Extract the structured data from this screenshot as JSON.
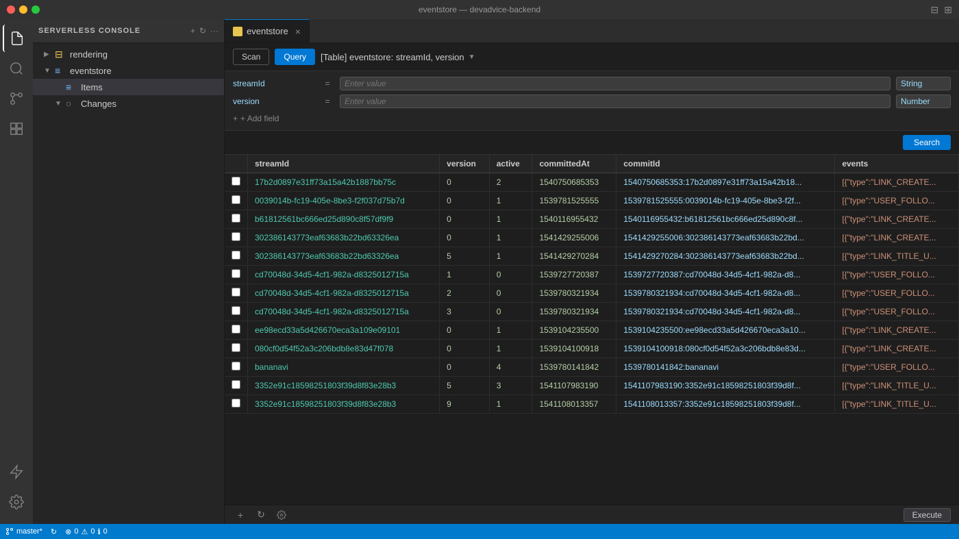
{
  "titleBar": {
    "title": "eventstore — devadvice-backend"
  },
  "activityBar": {
    "icons": [
      {
        "name": "files-icon",
        "symbol": "⎘",
        "active": true
      },
      {
        "name": "search-activity-icon",
        "symbol": "🔍"
      },
      {
        "name": "source-control-icon",
        "symbol": "⎇"
      },
      {
        "name": "extensions-icon",
        "symbol": "⊞"
      },
      {
        "name": "lightning-icon",
        "symbol": "⚡"
      },
      {
        "name": "settings-bottom-icon",
        "symbol": "⚙"
      }
    ]
  },
  "sidebar": {
    "header": "Serverless Console",
    "items": [
      {
        "id": "rendering",
        "label": "rendering",
        "icon": "▶",
        "indent": 1,
        "chevron": "▶",
        "expanded": false
      },
      {
        "id": "eventstore",
        "label": "eventstore",
        "icon": "⬜",
        "indent": 1,
        "chevron": "▼",
        "expanded": true
      },
      {
        "id": "items",
        "label": "Items",
        "icon": "≡",
        "indent": 2,
        "chevron": "",
        "selected": true
      },
      {
        "id": "changes",
        "label": "Changes",
        "icon": "○",
        "indent": 2,
        "chevron": "▼",
        "expanded": true
      }
    ]
  },
  "tab": {
    "label": "eventstore",
    "close": "×"
  },
  "queryBar": {
    "scanLabel": "Scan",
    "queryLabel": "Query",
    "selectorText": "[Table] eventstore: streamId, version",
    "selectorChevron": "▼"
  },
  "filters": [
    {
      "field": "streamId",
      "op": "=",
      "placeholder": "Enter value",
      "type": "String"
    },
    {
      "field": "version",
      "op": "=",
      "placeholder": "Enter value",
      "type": "Number"
    }
  ],
  "addField": "+ Add field",
  "searchButton": "Search",
  "table": {
    "columns": [
      "streamId",
      "version",
      "active",
      "committedAt",
      "commitId",
      "events"
    ],
    "rows": [
      {
        "streamId": "17b2d0897e31ff73a15a42b1887bb75c",
        "version": "0",
        "active": "2",
        "committedAt": "1540750685353",
        "commitId": "1540750685353:17b2d0897e31ff73a15a42b18...",
        "events": "[{\"type\":\"LINK_CREATE..."
      },
      {
        "streamId": "0039014b-fc19-405e-8be3-f2f037d75b7d",
        "version": "0",
        "active": "1",
        "committedAt": "1539781525555",
        "commitId": "1539781525555:0039014b-fc19-405e-8be3-f2f...",
        "events": "[{\"type\":\"USER_FOLLO..."
      },
      {
        "streamId": "b61812561bc666ed25d890c8f57df9f9",
        "version": "0",
        "active": "1",
        "committedAt": "1540116955432",
        "commitId": "1540116955432:b61812561bc666ed25d890c8f...",
        "events": "[{\"type\":\"LINK_CREATE..."
      },
      {
        "streamId": "302386143773eaf63683b22bd63326ea",
        "version": "0",
        "active": "1",
        "committedAt": "1541429255006",
        "commitId": "1541429255006:302386143773eaf63683b22bd...",
        "events": "[{\"type\":\"LINK_CREATE..."
      },
      {
        "streamId": "302386143773eaf63683b22bd63326ea",
        "version": "5",
        "active": "1",
        "committedAt": "1541429270284",
        "commitId": "1541429270284:302386143773eaf63683b22bd...",
        "events": "[{\"type\":\"LINK_TITLE_U..."
      },
      {
        "streamId": "cd70048d-34d5-4cf1-982a-d8325012715a",
        "version": "1",
        "active": "0",
        "committedAt": "1539727720387",
        "commitId": "1539727720387:cd70048d-34d5-4cf1-982a-d8...",
        "events": "[{\"type\":\"USER_FOLLO..."
      },
      {
        "streamId": "cd70048d-34d5-4cf1-982a-d8325012715a",
        "version": "2",
        "active": "0",
        "committedAt": "1539780321934",
        "commitId": "1539780321934:cd70048d-34d5-4cf1-982a-d8...",
        "events": "[{\"type\":\"USER_FOLLO..."
      },
      {
        "streamId": "cd70048d-34d5-4cf1-982a-d8325012715a",
        "version": "3",
        "active": "0",
        "committedAt": "1539780321934",
        "commitId": "1539780321934:cd70048d-34d5-4cf1-982a-d8...",
        "events": "[{\"type\":\"USER_FOLLO..."
      },
      {
        "streamId": "ee98ecd33a5d426670eca3a109e09101",
        "version": "0",
        "active": "1",
        "committedAt": "1539104235500",
        "commitId": "1539104235500:ee98ecd33a5d426670eca3a10...",
        "events": "[{\"type\":\"LINK_CREATE..."
      },
      {
        "streamId": "080cf0d54f52a3c206bdb8e83d47f078",
        "version": "0",
        "active": "1",
        "committedAt": "1539104100918",
        "commitId": "1539104100918:080cf0d54f52a3c206bdb8e83d...",
        "events": "[{\"type\":\"LINK_CREATE..."
      },
      {
        "streamId": "bananavi",
        "version": "0",
        "active": "4",
        "committedAt": "1539780141842",
        "commitId": "1539780141842:bananavi",
        "events": "[{\"type\":\"USER_FOLLO..."
      },
      {
        "streamId": "3352e91c18598251803f39d8f83e28b3",
        "version": "5",
        "active": "3",
        "committedAt": "1541107983190",
        "commitId": "1541107983190:3352e91c18598251803f39d8f...",
        "events": "[{\"type\":\"LINK_TITLE_U..."
      },
      {
        "streamId": "3352e91c18598251803f39d8f83e28b3",
        "version": "9",
        "active": "1",
        "committedAt": "1541108013357",
        "commitId": "1541108013357:3352e91c18598251803f39d8f...",
        "events": "[{\"type\":\"LINK_TITLE_U..."
      }
    ]
  },
  "bottomToolbar": {
    "addIcon": "+",
    "refreshIcon": "↻",
    "settingsIcon": "⚙",
    "executeLabel": "Execute"
  },
  "statusBar": {
    "branch": "master*",
    "sync": "↻",
    "errors": "0",
    "warnings": "0",
    "info": "0",
    "rightItems": []
  }
}
